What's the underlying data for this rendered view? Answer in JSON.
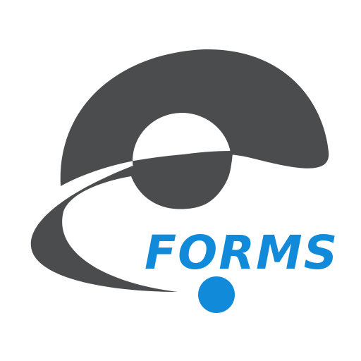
{
  "logo": {
    "wordmark": "FORMS",
    "colors": {
      "mark": "#4b4c4e",
      "accent": "#118bd9",
      "background": "#ffffff"
    }
  }
}
